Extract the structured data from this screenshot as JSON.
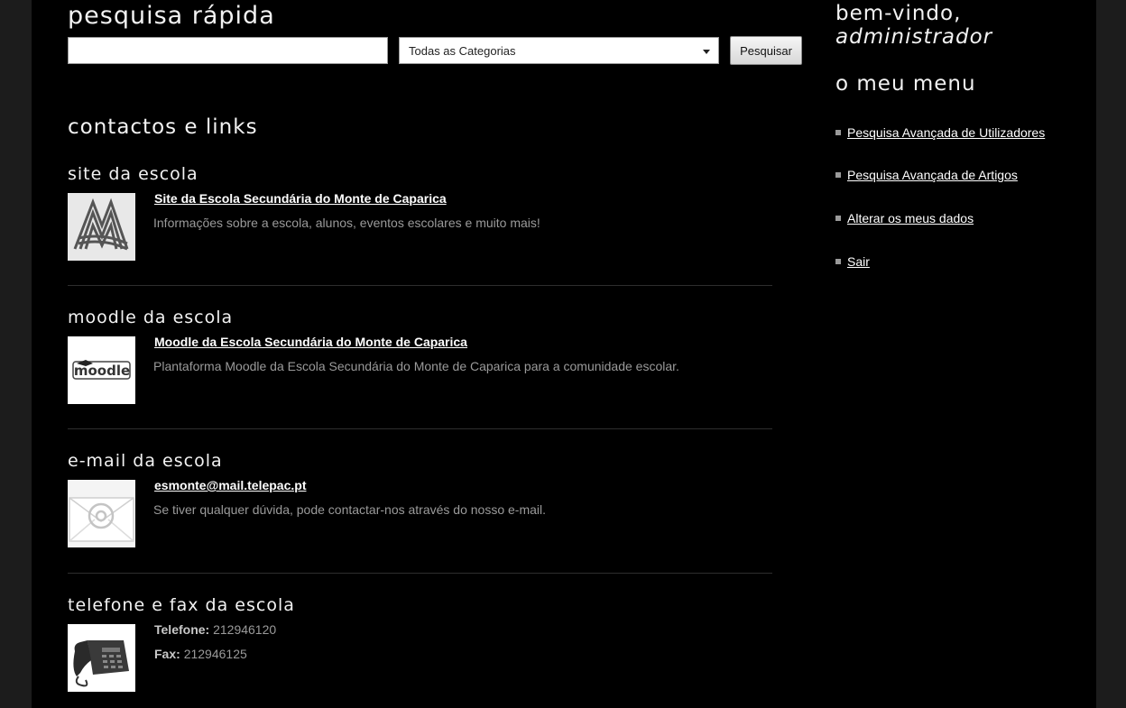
{
  "search": {
    "title": "pesquisa rápida",
    "input_value": "",
    "category_selected": "Todas as Categorias",
    "button_label": "Pesquisar"
  },
  "contacts": {
    "title": "contactos e links",
    "items": [
      {
        "title": "site da escola",
        "link": "Site da Escola Secundária do Monte de Caparica",
        "description": "Informações sobre a escola, alunos, eventos escolares e muito mais!",
        "icon": "school-logo-icon"
      },
      {
        "title": "moodle da escola",
        "link": "Moodle da Escola Secundária do Monte de Caparica",
        "description": "Plantaforma Moodle da Escola Secundária do Monte de Caparica para a comunidade escolar.",
        "icon": "moodle-logo-icon",
        "logo_text": "moodle"
      },
      {
        "title": "e-mail da escola",
        "link": "esmonte@mail.telepac.pt",
        "description": "Se tiver qualquer dúvida, pode contactar-nos através do nosso e-mail.",
        "icon": "email-icon"
      },
      {
        "title": "telefone e fax da escola",
        "phone_label": "Telefone:",
        "phone_value": "212946120",
        "fax_label": "Fax:",
        "fax_value": "212946125",
        "icon": "telephone-icon"
      }
    ]
  },
  "sidebar": {
    "welcome_text": "bem-vindo,",
    "user_name": "administrador",
    "menu_title": "o meu menu",
    "menu_items": [
      {
        "label": "Pesquisa Avançada de Utilizadores"
      },
      {
        "label": "Pesquisa Avançada de Artigos"
      },
      {
        "label": "Alterar os meus dados"
      },
      {
        "label": "Sair"
      }
    ]
  },
  "colors": {
    "background": "#000000",
    "side_background": "#1c1c1c",
    "heading": "#f2f2f2",
    "description": "#9a9a9a",
    "link": "#ffffff"
  }
}
